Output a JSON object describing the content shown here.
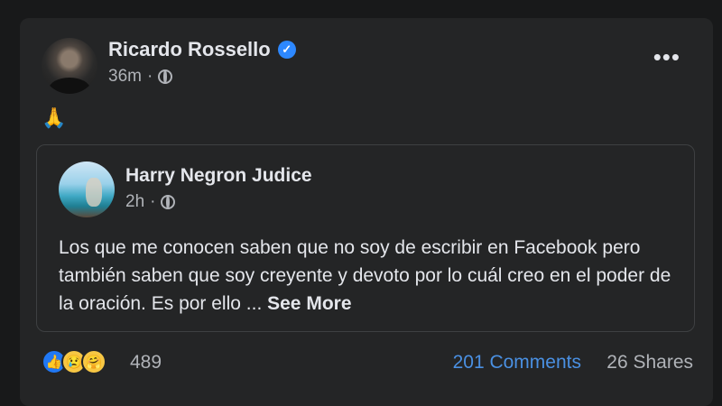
{
  "post": {
    "author": "Ricardo Rossello",
    "time": "36m",
    "separator": "·",
    "content_emoji": "🙏",
    "more_icon": "more-dots-icon"
  },
  "shared_post": {
    "author": "Harry Negron Judice",
    "time": "2h",
    "separator": "·",
    "text": "Los que me conocen saben que no soy de escribir en Facebook pero también saben que soy creyente y devoto por lo cuál creo en el poder de la oración. Es por ello ... ",
    "see_more": "See More"
  },
  "footer": {
    "reaction_count": "489",
    "comments": "201 Comments",
    "shares": "26 Shares"
  },
  "colors": {
    "background": "#18191a",
    "card": "#242526",
    "text": "#e4e6eb",
    "muted": "#b0b3b8",
    "link": "#4a90e2",
    "verified": "#2d88ff"
  }
}
